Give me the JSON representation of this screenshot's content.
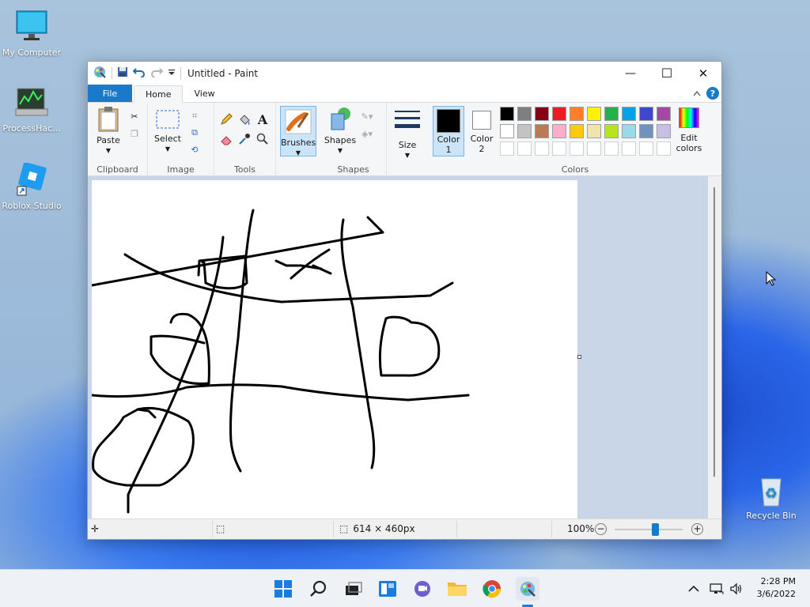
{
  "desktop": {
    "icons": [
      {
        "label": "My Computer"
      },
      {
        "label": "ProcessHac..."
      },
      {
        "label": "Roblox Studio"
      },
      {
        "label": "Recycle Bin"
      }
    ]
  },
  "window": {
    "title": "Untitled - Paint",
    "controls": {
      "minimize": "—",
      "maximize": "☐",
      "close": "✕"
    }
  },
  "menu": {
    "file": "File",
    "home": "Home",
    "view": "View",
    "help": "?"
  },
  "ribbon": {
    "clipboard": {
      "label": "Clipboard",
      "paste": "Paste"
    },
    "image": {
      "label": "Image",
      "select": "Select"
    },
    "tools": {
      "label": "Tools",
      "text_glyph": "A"
    },
    "brushes": {
      "label": "Brushes"
    },
    "shapes": {
      "label": "Shapes",
      "shapes_btn": "Shapes"
    },
    "size": {
      "label": "Size"
    },
    "colors": {
      "label": "Colors",
      "color1": {
        "line1": "Color",
        "line2": "1",
        "value": "#000000"
      },
      "color2": {
        "line1": "Color",
        "line2": "2",
        "value": "#ffffff"
      },
      "edit": {
        "line1": "Edit",
        "line2": "colors"
      },
      "palette_row1": [
        "#000000",
        "#7f7f7f",
        "#880015",
        "#ed1c24",
        "#ff7f27",
        "#fff200",
        "#22b14c",
        "#00a2e8",
        "#3f48cc",
        "#a349a4"
      ],
      "palette_row2": [
        "#ffffff",
        "#c3c3c3",
        "#b97a57",
        "#ffaec9",
        "#ffc90e",
        "#efe4b0",
        "#b5e61d",
        "#99d9ea",
        "#7092be",
        "#c8bfe7"
      ]
    }
  },
  "status": {
    "dimensions": "614 × 460px",
    "zoom": "100%",
    "zoom_fraction": 0.6
  },
  "taskbar": {
    "time": "2:28 PM",
    "date": "3/6/2022"
  }
}
